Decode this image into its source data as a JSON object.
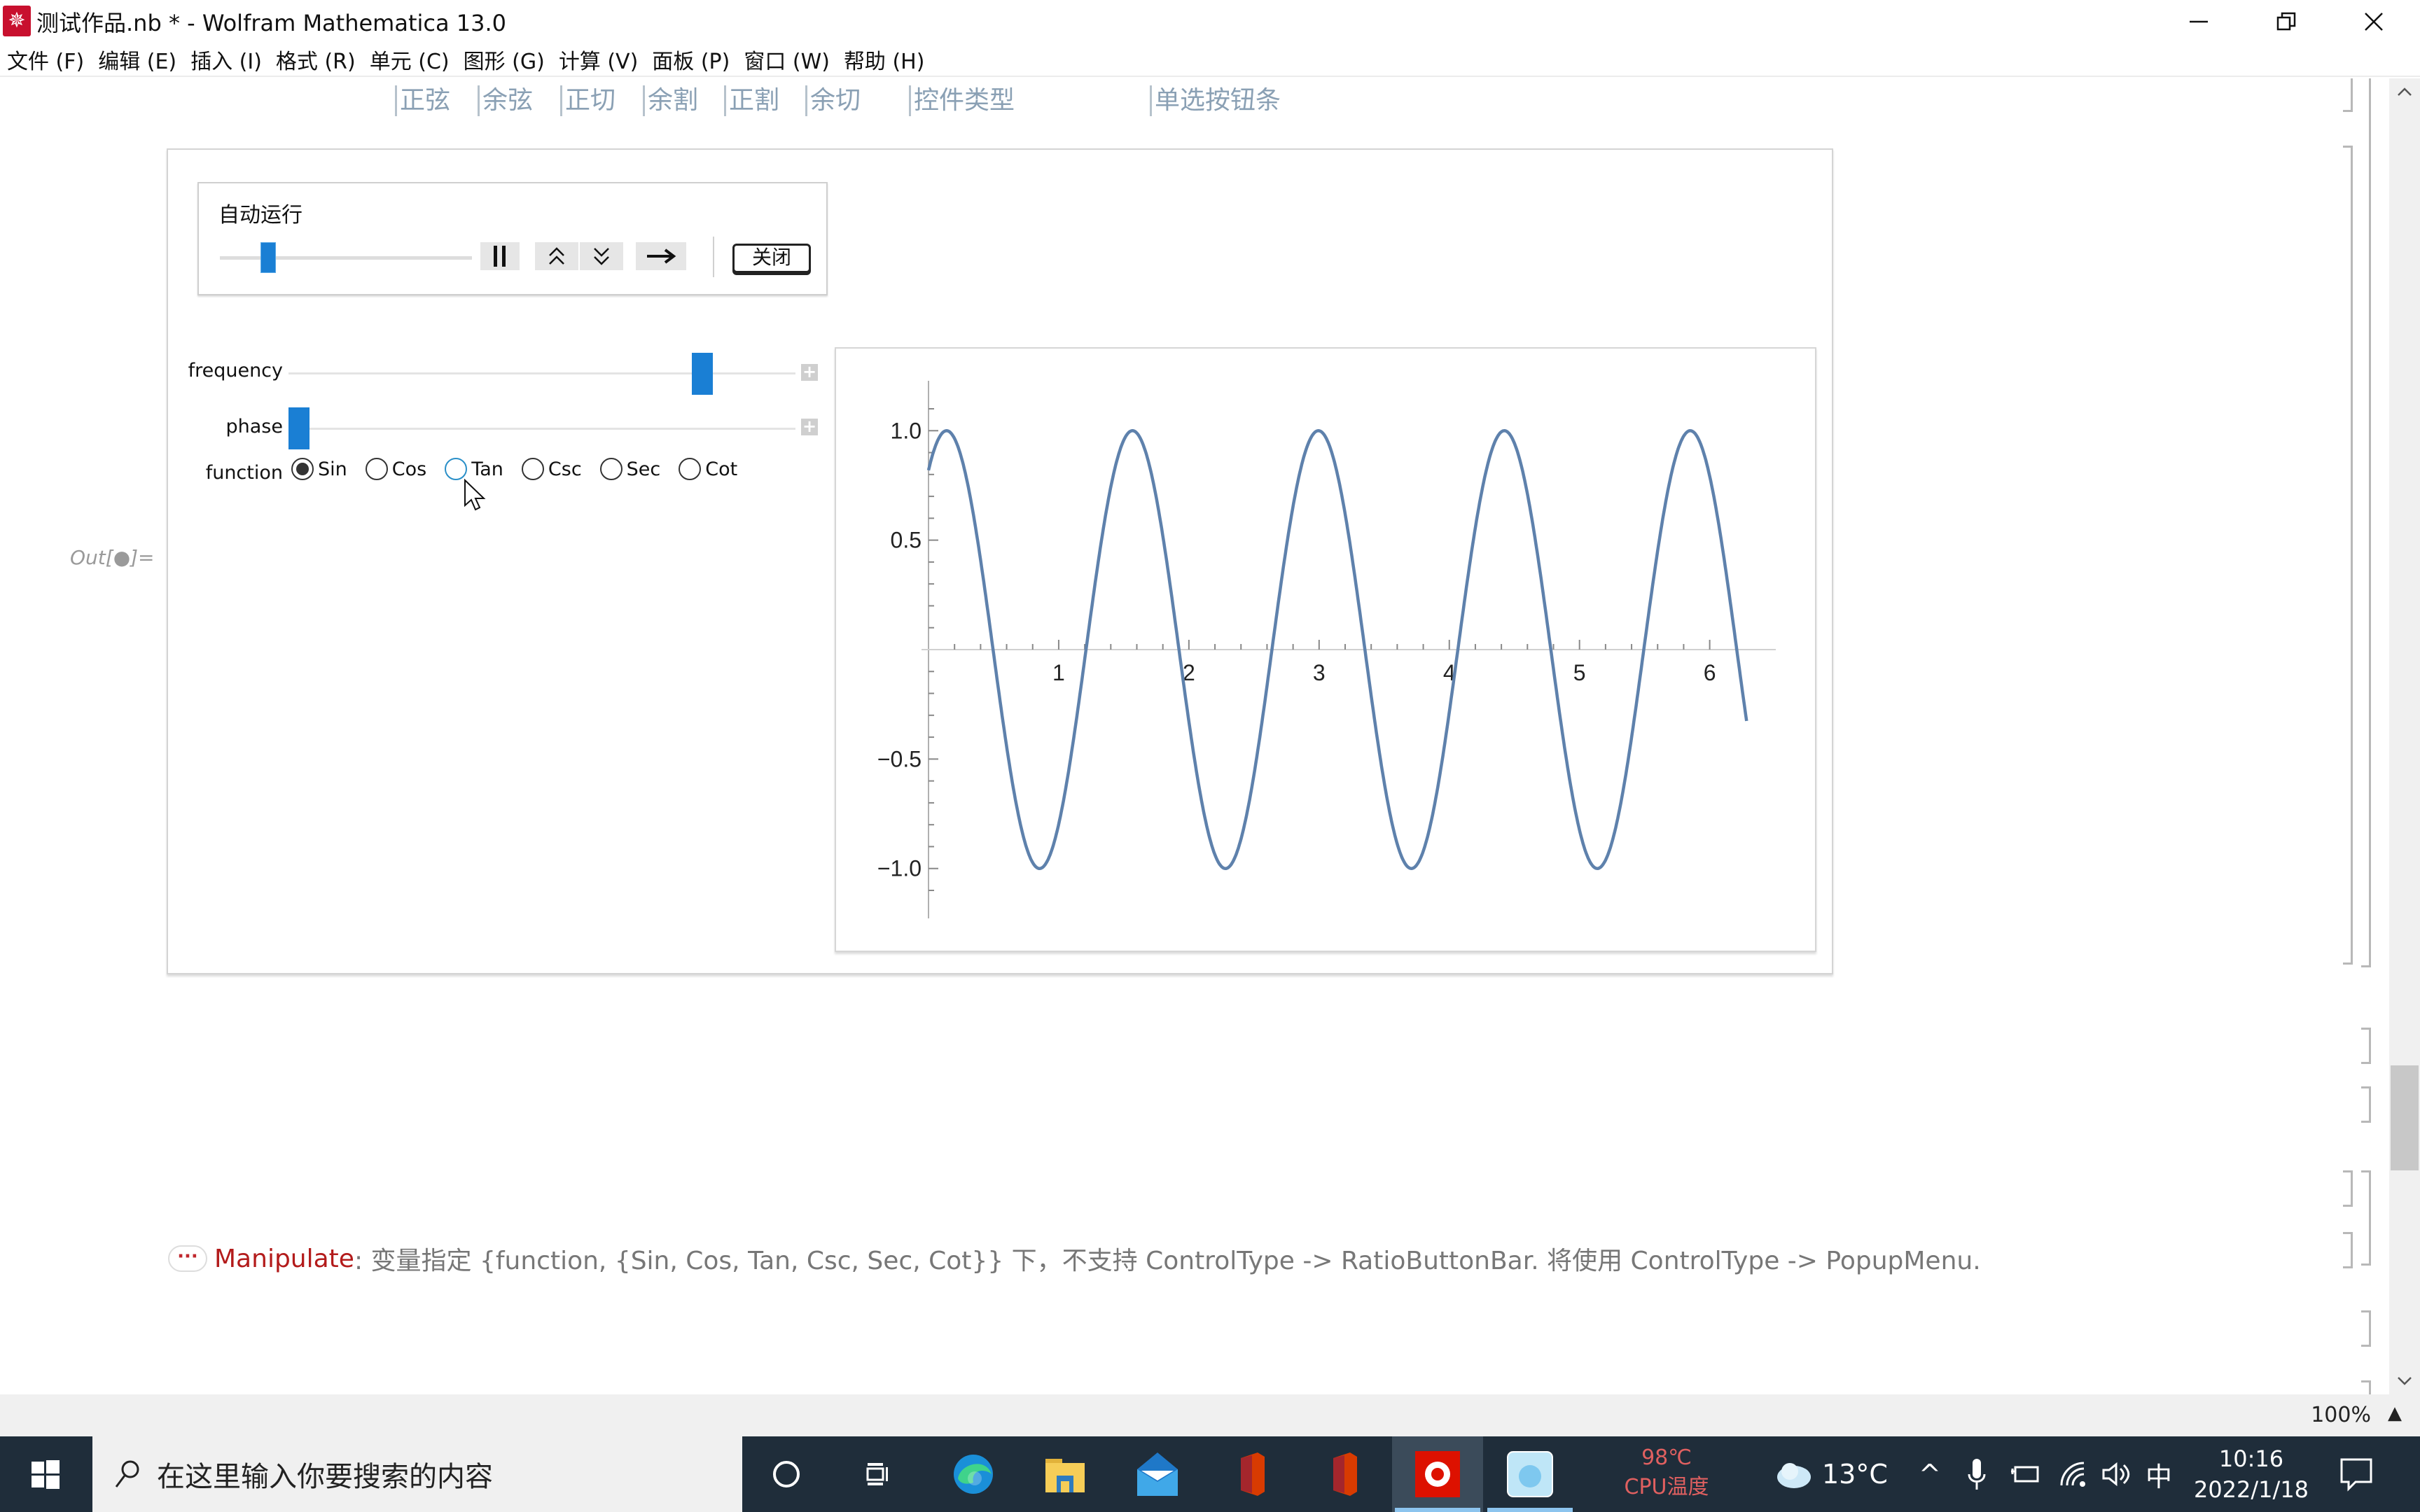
{
  "window": {
    "title": "测试作品.nb * - Wolfram Mathematica 13.0",
    "app_icon": "mathematica-icon",
    "controls": {
      "minimize": "minimize-icon",
      "restore": "restore-icon",
      "close": "close-icon"
    }
  },
  "menubar": {
    "items": [
      {
        "label": "文件 (F)"
      },
      {
        "label": "编辑 (E)"
      },
      {
        "label": "插入 (I)"
      },
      {
        "label": "格式 (R)"
      },
      {
        "label": "单元 (C)"
      },
      {
        "label": "图形 (G)"
      },
      {
        "label": "计算 (V)"
      },
      {
        "label": "面板 (P)"
      },
      {
        "label": "窗口 (W)"
      },
      {
        "label": "帮助 (H)"
      }
    ]
  },
  "notebook": {
    "section_labels": [
      "正弦",
      "余弦",
      "正切",
      "余割",
      "正割",
      "余切",
      "控件类型",
      "单选按钮条"
    ],
    "out_label": "Out[●]=",
    "manipulate": {
      "autorun": {
        "title": "自动运行",
        "animation_position": 0.18,
        "buttons": {
          "pause": "pause-icon",
          "faster": "double-chevron-up-icon",
          "slower": "double-chevron-down-icon",
          "direction": "arrow-right-icon"
        },
        "close_label": "关闭"
      },
      "controls": {
        "frequency": {
          "label": "frequency",
          "fraction": 0.83
        },
        "phase": {
          "label": "phase",
          "fraction": 0.0
        },
        "function": {
          "label": "function",
          "options": [
            "Sin",
            "Cos",
            "Tan",
            "Csc",
            "Sec",
            "Cot"
          ],
          "selected": "Sin",
          "hovered": "Tan"
        }
      }
    },
    "message": {
      "icon": "ellipsis-icon",
      "head": "Manipulate",
      "text": ": 变量指定 {function, {Sin, Cos, Tan, Csc, Sec, Cot}} 下，不支持 ControlType -> RatioButtonBar. 将使用 ControlType -> PopupMenu."
    }
  },
  "statusbar": {
    "zoom": "100%"
  },
  "taskbar": {
    "search_placeholder": "在这里输入你要搜索的内容",
    "apps": [
      "cortana-icon",
      "task-view-icon",
      "edge-icon",
      "file-explorer-icon",
      "mail-icon",
      "office-icon",
      "office-icon-2",
      "mathematica-icon",
      "anime-app-icon"
    ],
    "cpu_temp": "98℃",
    "cpu_label": "CPU温度",
    "weather": "13°C",
    "ime": "中",
    "time": "10:16",
    "date": "2022/1/18"
  },
  "chart_data": {
    "type": "line",
    "title": "",
    "xlabel": "",
    "ylabel": "",
    "function": "sin(4.4 x + 0.96)",
    "x_range": [
      0,
      6.2832
    ],
    "xlim": [
      0,
      6.4
    ],
    "ylim": [
      -1.1,
      1.1
    ],
    "x_ticks": [
      1,
      2,
      3,
      4,
      5,
      6
    ],
    "x_tick_labels": [
      "1",
      "2",
      "3",
      "4",
      "5",
      "6"
    ],
    "y_ticks": [
      -1.0,
      -0.5,
      0.5,
      1.0
    ],
    "y_tick_labels": [
      "−1.0",
      "−0.5",
      "0.5",
      "1.0"
    ],
    "series": [
      {
        "name": "Sin",
        "color": "#5e81ac",
        "frequency": 4.4,
        "phase": 0.96
      }
    ],
    "grid": false,
    "legend": "none"
  }
}
